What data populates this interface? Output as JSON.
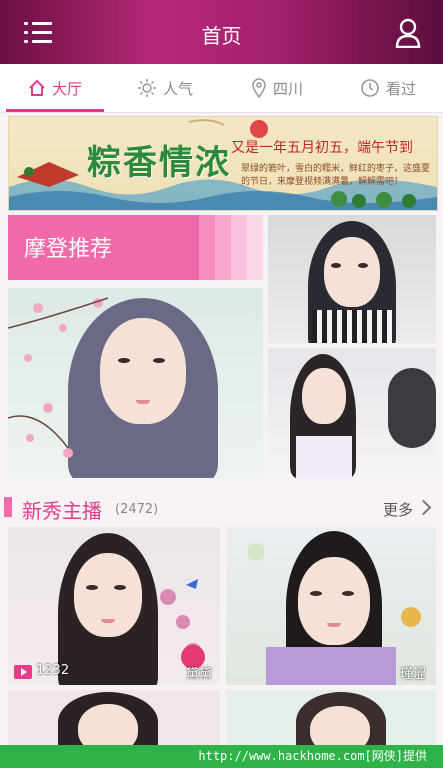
{
  "header": {
    "title": "首页"
  },
  "tabs": [
    {
      "label": "大厅",
      "icon": "home-icon"
    },
    {
      "label": "人气",
      "icon": "sun-icon"
    },
    {
      "label": "四川",
      "icon": "location-pin-icon"
    },
    {
      "label": "看过",
      "icon": "clock-icon"
    }
  ],
  "banner": {
    "headline": "粽香情浓",
    "line1": "又是一年五月初五，端午节到",
    "line2": "翠绿的箬叶，雪白的糯米，鲜红的枣子，这盛夏的节日，来摩登视频满满暑，解解需吧！"
  },
  "sections": {
    "recommend_title": "摩登推荐",
    "new_title": "新秀主播",
    "new_count": "(2472)",
    "more_label": "更多"
  },
  "cards": [
    {
      "views": "1232",
      "name": "黛黛"
    },
    {
      "name": "瑾涩"
    }
  ],
  "footer": {
    "text": "http://www.hackhome.com[网侠]提供"
  },
  "colors": {
    "accent": "#e43b8a",
    "pink": "#f06aaa",
    "header": "#a62170",
    "footer": "#2fb248"
  }
}
